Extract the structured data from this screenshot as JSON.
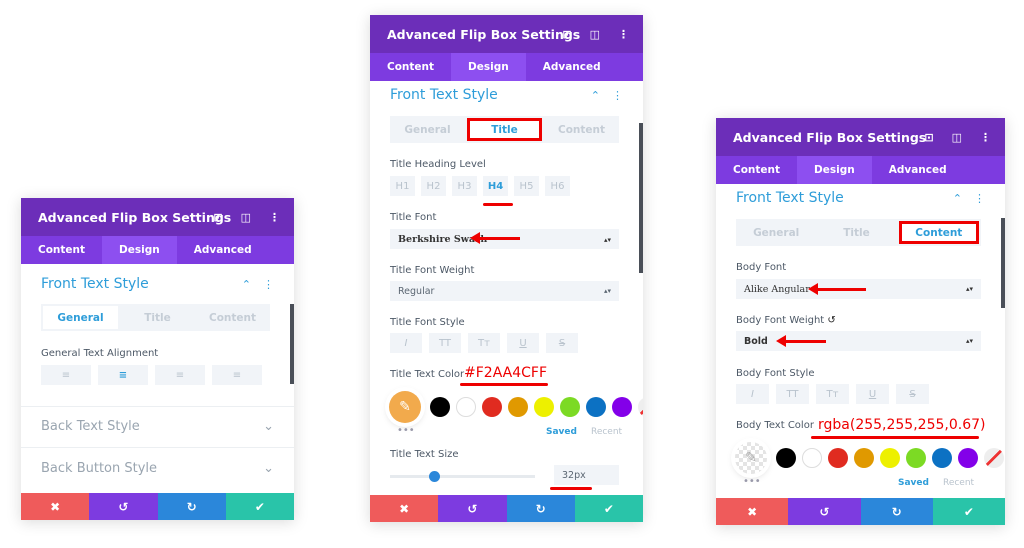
{
  "colors": {
    "header": "#6c2eb9",
    "tabs": "#7d3be0",
    "accent": "#2e9dd9",
    "cancel": "#ef5b5b",
    "undo": "#7d3be0",
    "redo": "#2b87da",
    "save": "#29c4a9",
    "annotation": "#e00000"
  },
  "panel_title": "Advanced Flip Box Settings",
  "tabs": [
    "Content",
    "Design",
    "Advanced"
  ],
  "section": "Front Text Style",
  "subtabs": [
    "General",
    "Title",
    "Content"
  ],
  "icons": {
    "header": [
      "focus-icon",
      "split-view-icon",
      "more-icon"
    ],
    "footer": [
      "close-icon",
      "undo-icon",
      "redo-icon",
      "check-icon"
    ]
  },
  "footer_glyphs": [
    "✖",
    "↺",
    "↻",
    "✔"
  ],
  "swatches": [
    "#000000",
    "#ffffff",
    "#e02b20",
    "#e09900",
    "#edf000",
    "#7cda24",
    "#0c71c3",
    "#8300e9"
  ],
  "saved": "Saved",
  "recent": "Recent",
  "font_style_buttons": [
    "I",
    "TT",
    "Tт",
    "U",
    "S"
  ],
  "panel1": {
    "field": "General Text Alignment",
    "align": [
      "left",
      "center",
      "right",
      "justify"
    ],
    "active_align": 1,
    "collapsed": [
      "Back Text Style",
      "Back Button Style"
    ]
  },
  "panel2": {
    "heading_label": "Title Heading Level",
    "headings": [
      "H1",
      "H2",
      "H3",
      "H4",
      "H5",
      "H6"
    ],
    "active_heading": 3,
    "font_label": "Title Font",
    "font": "Berkshire Swash",
    "weight_label": "Title Font Weight",
    "weight": "Regular",
    "style_label": "Title Font Style",
    "color_label": "Title Text Color",
    "color_note": "#F2AA4CFF",
    "picked_color": "#f2aa4c",
    "size_label": "Title Text Size",
    "size": "32px",
    "size_slider_percent": 30
  },
  "panel3": {
    "font_label": "Body Font",
    "font": "Alike Angular",
    "weight_label": "Body Font Weight",
    "weight": "Bold",
    "style_label": "Body Font Style",
    "color_label": "Body Text Color",
    "color_note": "rgba(255,255,255,0.67)"
  }
}
